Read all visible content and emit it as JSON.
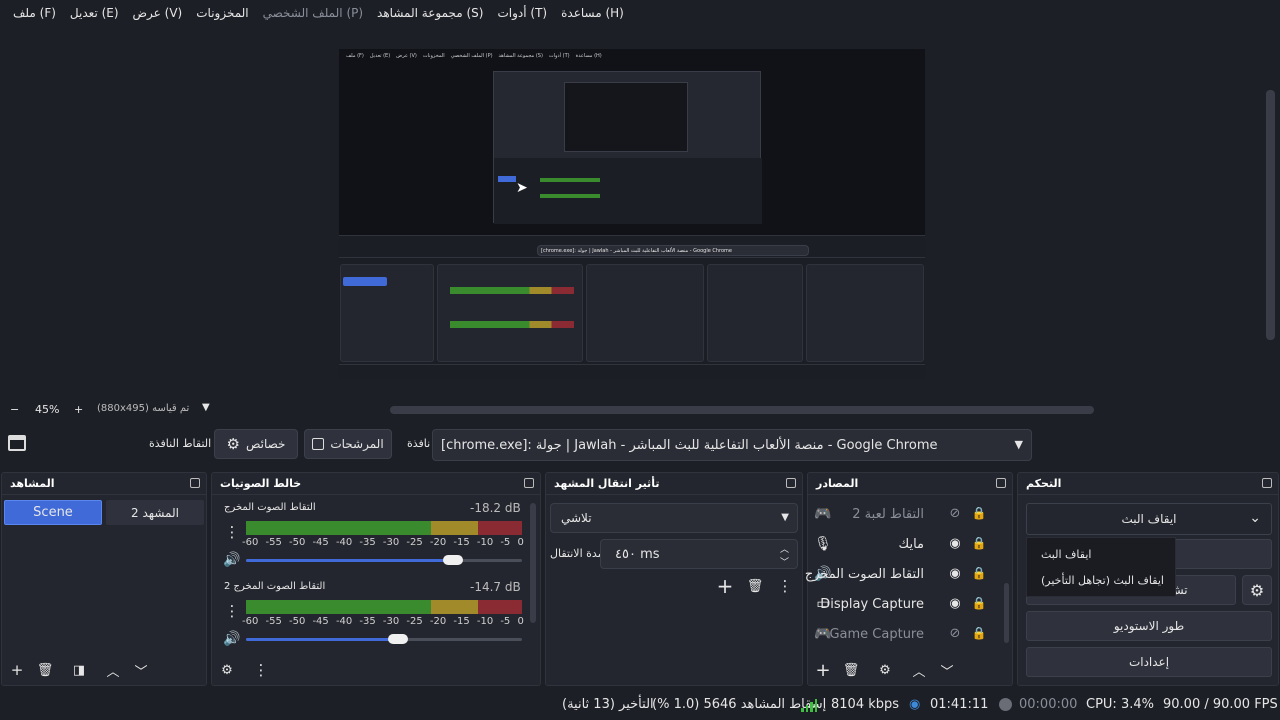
{
  "menu": [
    "ملف (F)",
    "تعديل (E)",
    "عرض (V)",
    "المخزونات",
    "الملف الشخصي (P)",
    "مجموعة المشاهد (S)",
    "أدوات (T)",
    "مساعدة (H)"
  ],
  "zoom": {
    "minus": "−",
    "value": "45%",
    "plus": "+",
    "size": "(880x495) تم قياسه"
  },
  "source_toolbar": {
    "window_capture": "التقاط النافذة",
    "properties": "خصائص",
    "filters": "المرشحات",
    "window_label": "نافذة",
    "window_value": "[chrome.exe]: جولة | Jawlah - منصة الألعاب التفاعلية للبث المباشر - Google Chrome"
  },
  "scenes": {
    "title": "المشاهد",
    "items": [
      "Scene",
      "المشهد 2"
    ]
  },
  "mixer": {
    "title": "خالط الصوتيات",
    "ticks": [
      "-60",
      "-55",
      "-50",
      "-45",
      "-40",
      "-35",
      "-30",
      "-25",
      "-20",
      "-15",
      "-10",
      "-5",
      "0"
    ],
    "channels": [
      {
        "name": "التقاط الصوت المخرج",
        "db": "-18.2 dB",
        "volume": 0.75
      },
      {
        "name": "التقاط الصوت المخرج 2",
        "db": "-14.7 dB",
        "volume": 0.55
      }
    ]
  },
  "transitions": {
    "title": "تأثير انتقال المشهد",
    "type": "تلاشي",
    "duration_label": "مدة الانتقال",
    "duration_value": "٤٥٠ ms"
  },
  "sources": {
    "title": "المصادر",
    "items": [
      {
        "name": "التقاط لعبة 2",
        "icon": "gamepad-icon",
        "visible": false,
        "dim": true
      },
      {
        "name": "مايك",
        "icon": "microphone-icon",
        "visible": true,
        "dim": false
      },
      {
        "name": "التقاط الصوت المخرج",
        "icon": "speaker-icon",
        "visible": true,
        "dim": false
      },
      {
        "name": "Display Capture",
        "icon": "monitor-icon",
        "visible": true,
        "dim": false
      },
      {
        "name": "Game Capture",
        "icon": "gamepad-icon",
        "visible": false,
        "dim": true
      }
    ]
  },
  "controls": {
    "title": "التحكم",
    "stop_stream": "ايقاف البث",
    "dropdown": [
      "ايقاف البث",
      "ايقاف البث (تجاهل التأخير)"
    ],
    "studio_mode": "طور الاستوديو",
    "settings": "إعدادات",
    "partial": "تش"
  },
  "status": {
    "delay": "التأخير (13 ثانية)",
    "dropped": "إسقاط المشاهد 5646 (1.0 %)",
    "kbps": "8104 kbps",
    "stream_time": "01:41:11",
    "rec_time": "00:00:00",
    "cpu": "CPU: 3.4%",
    "fps": "90.00 / 90.00 FPS"
  },
  "colors": {
    "accent": "#3f6ad8",
    "meter_green": "#3a8a2e",
    "meter_yellow": "#a08a2a",
    "meter_red": "#8a2a33",
    "bg": "#1d1f26",
    "panel": "#23262e"
  }
}
